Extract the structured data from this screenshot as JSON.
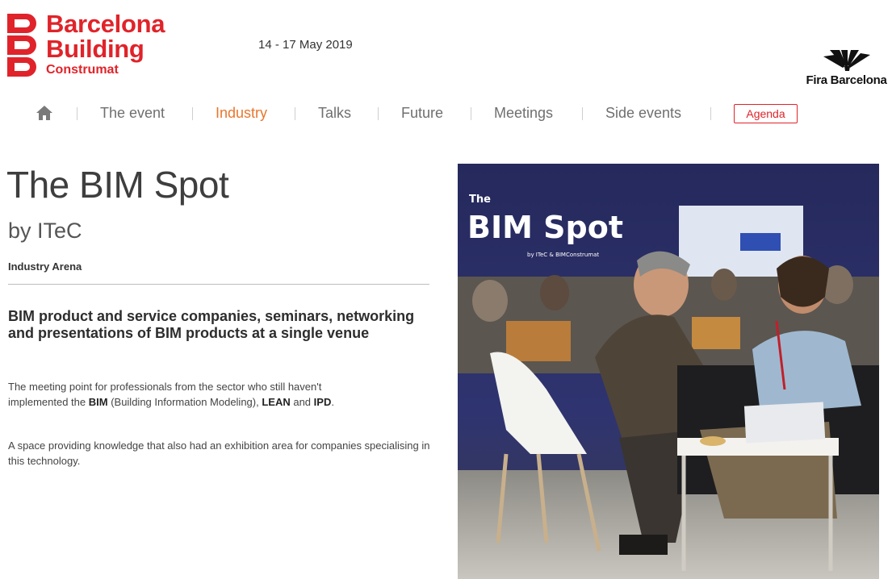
{
  "header": {
    "logo": {
      "line1": "Barcelona",
      "line2": "Building",
      "line3": "Construmat"
    },
    "dates": "14 - 17 May 2019",
    "partner": "Fira Barcelona",
    "brand_color": "#e0232a"
  },
  "nav": {
    "home_icon": "home-icon",
    "items": [
      {
        "label": "The event"
      },
      {
        "label": "Industry",
        "active": true
      },
      {
        "label": "Talks"
      },
      {
        "label": "Future"
      },
      {
        "label": "Meetings"
      },
      {
        "label": "Side events"
      }
    ],
    "agenda": "Agenda",
    "active_color": "#e8772e"
  },
  "main": {
    "title": "The BIM Spot",
    "subtitle": "by ITeC",
    "area": "Industry Arena",
    "lead": "BIM product and service companies, seminars, networking and presentations of BIM products at a single venue",
    "p1": {
      "t1": "The meeting point for professionals from the sector who still haven't implemented the ",
      "b1": "BIM",
      "t2": " (Building Information Modeling), ",
      "b2": "LEAN",
      "t3": " and ",
      "b3": "IPD",
      "t4": "."
    },
    "p2": "A space providing knowledge that also had an exhibition area for companies specialising in this technology."
  },
  "photo": {
    "sign_small": "The",
    "sign_title": "BIM Spot",
    "sign_credit": "by ITeC & BIMConstrumat"
  }
}
